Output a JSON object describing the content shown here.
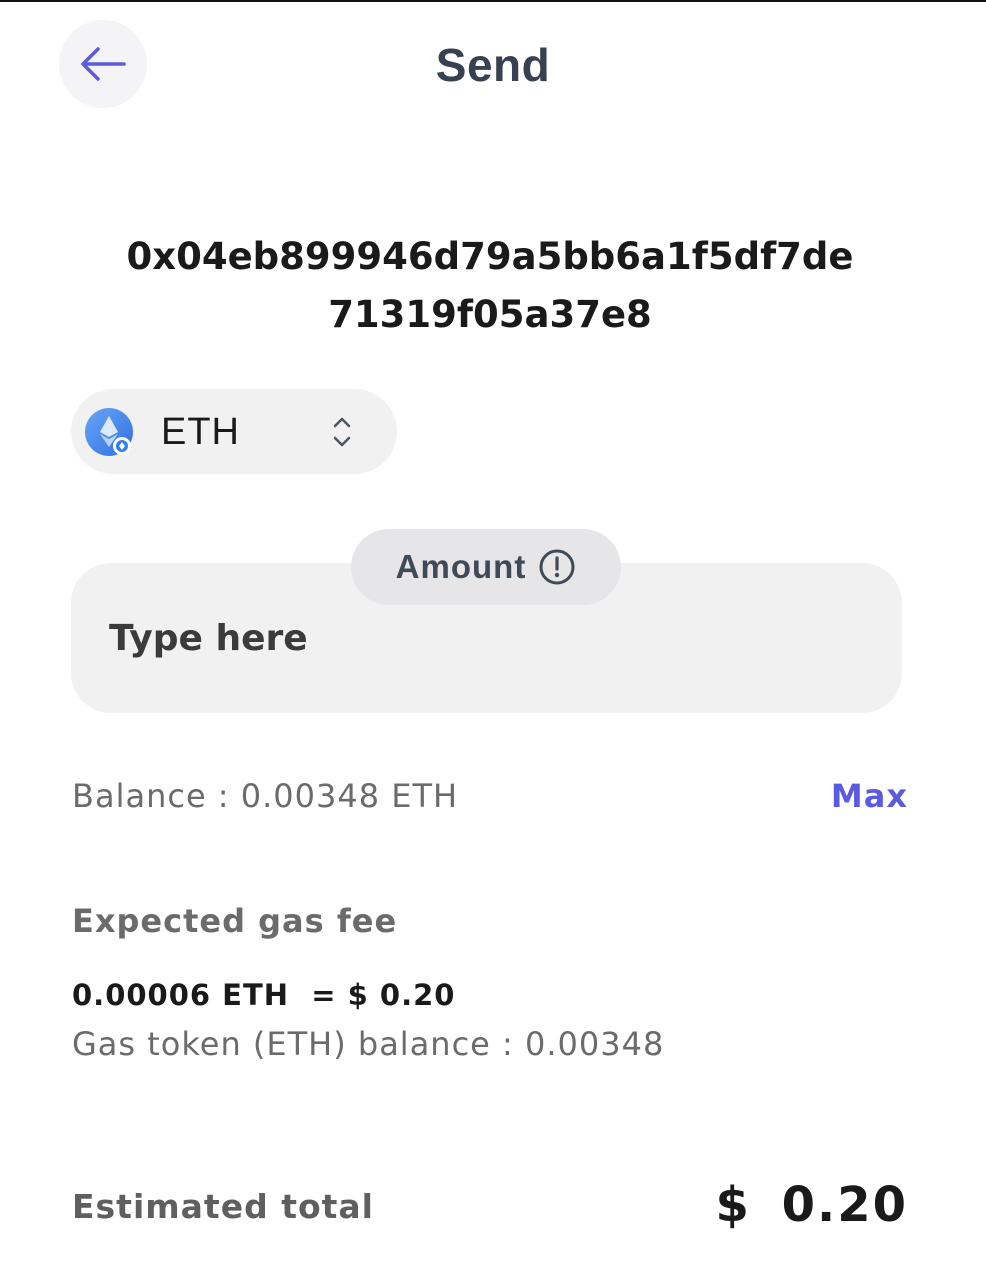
{
  "header": {
    "title": "Send",
    "back_icon": "arrow-left-icon",
    "accent_color": "#5a5be0"
  },
  "recipient": {
    "address": "0x04eb899946d79a5bb6a1f5df7de71319f05a37e8"
  },
  "token": {
    "symbol": "ETH",
    "icon": "eth-token-icon",
    "selector_icon": "chevron-up-down-icon"
  },
  "amount": {
    "label": "Amount",
    "placeholder": "Type here",
    "value": "",
    "info_icon": "info-circle-icon"
  },
  "balance": {
    "text": "Balance : 0.00348 ETH",
    "max_label": "Max"
  },
  "gas": {
    "heading": "Expected gas fee",
    "fee": "0.00006 ETH  = $ 0.20",
    "token_balance": "Gas token (ETH) balance : 0.00348"
  },
  "total": {
    "label": "Estimated total",
    "value": "$ 0.20"
  }
}
